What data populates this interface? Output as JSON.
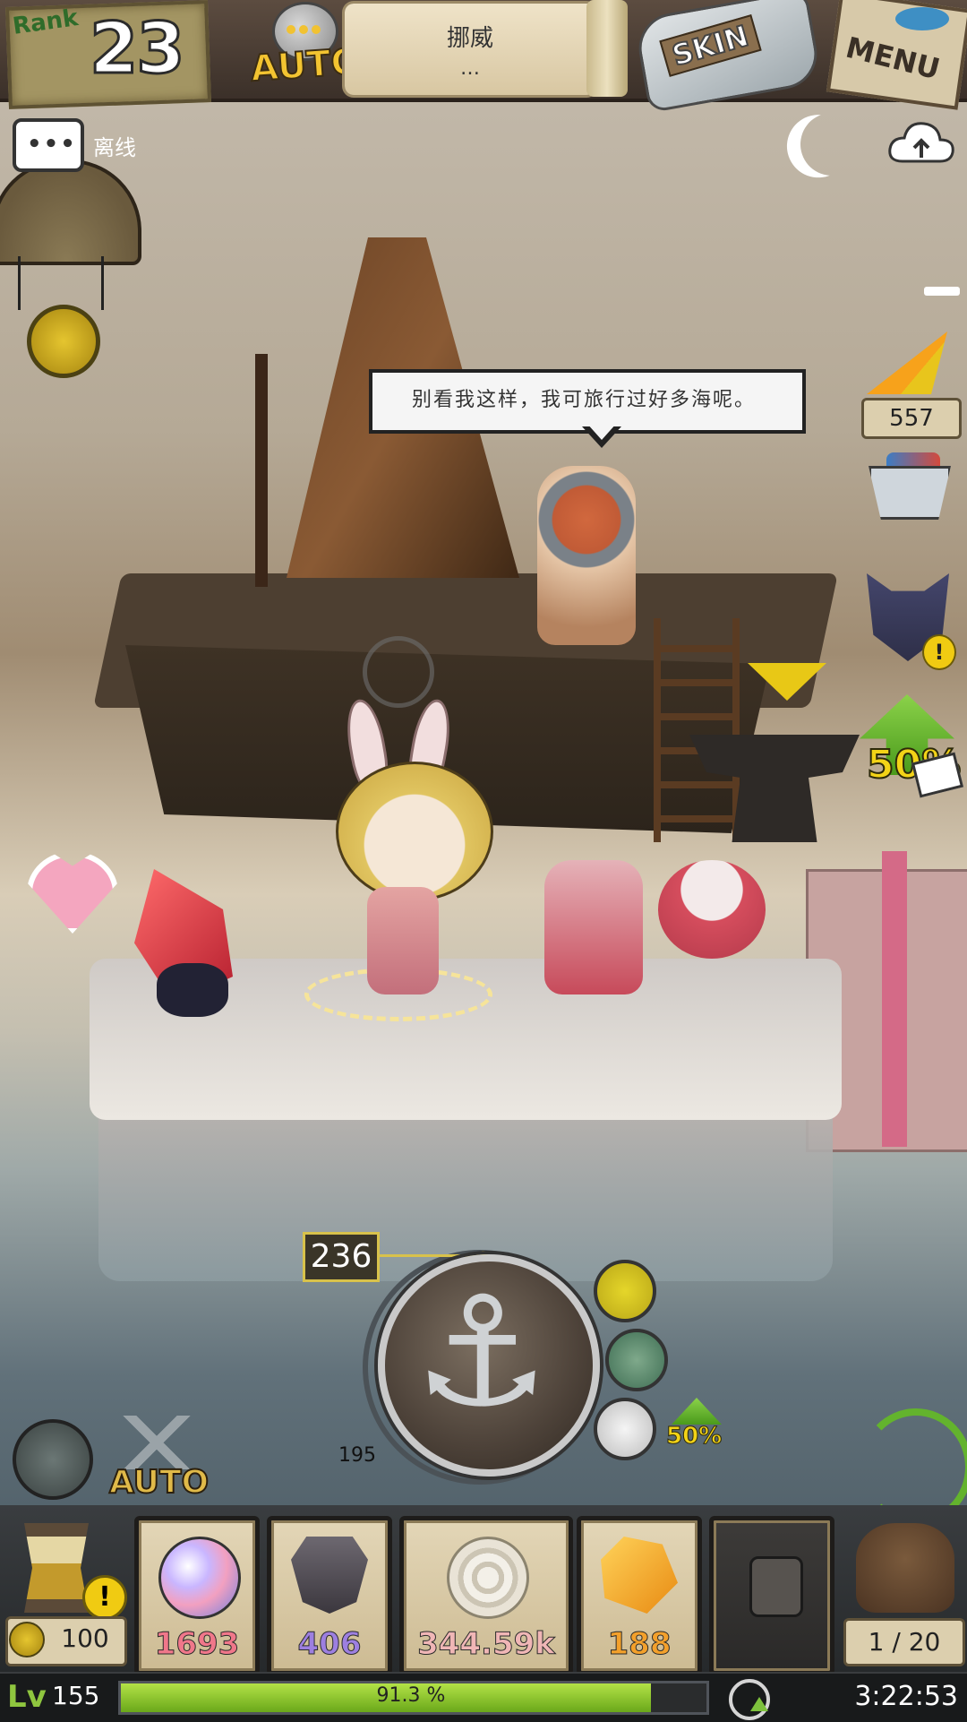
{
  "rank": {
    "label": "Rank",
    "value": "23"
  },
  "auto_toggle": {
    "label": "AUTO"
  },
  "scroll": {
    "location": "挪威",
    "subtitle": "…"
  },
  "skin_button": {
    "label": "SKIN"
  },
  "menu_button": {
    "label": "MENU"
  },
  "chat": {
    "status": "离线",
    "bubble_text": "•••"
  },
  "npc_dialogue": "别看我这样，我可旅行过好多海呢。",
  "right_panel": {
    "candy_count": "557",
    "boost_percent": "50%"
  },
  "anchor_hud": {
    "depth_value": "236",
    "depth_min": "195",
    "boost_percent": "50%",
    "anchor_glyph": "⚓"
  },
  "auto_battle": {
    "label": "AUTO"
  },
  "resources": {
    "coins": "100",
    "gem": {
      "value": "1693",
      "color": "#f0778a"
    },
    "shield": {
      "value": "406",
      "color": "#9d7fe0"
    },
    "shell": {
      "value": "344.59k",
      "color": "#f0b6b6"
    },
    "amber": {
      "value": "188",
      "color": "#f3a02b"
    },
    "bag": "1 / 20"
  },
  "status": {
    "level_icon": "Lv",
    "level": "155",
    "xp_percent_text": "91.3 %",
    "xp_fraction": 0.913,
    "time": "3:22:53"
  },
  "colors": {
    "accent_yellow": "#f3c431",
    "xp_green": "#8fc63f"
  }
}
